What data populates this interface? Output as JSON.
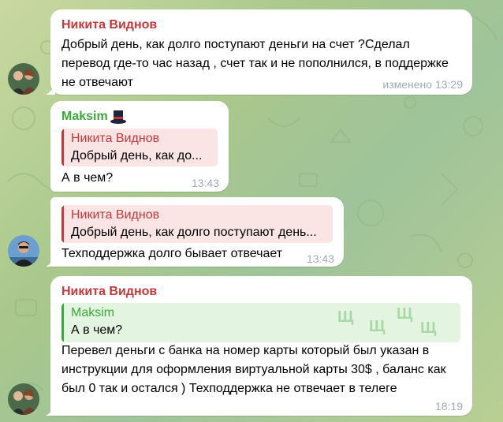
{
  "messages": [
    {
      "sender": "Никита Виднов",
      "text": "Добрый день, как долго поступают деньги на счет ?Сделал перевод где-то час назад , счет так и не пополнился, в поддержке не отвечают",
      "time": "изменено 13:29"
    },
    {
      "sender": "Maksim",
      "badge_icon": "top-hat-emoji-icon",
      "reply": {
        "name": "Никита Виднов",
        "text": "Добрый день, как до..."
      },
      "text": "А в чем?",
      "time": "13:43"
    },
    {
      "reply": {
        "name": "Никита Виднов",
        "text": "Добрый день, как долго поступают день..."
      },
      "text": "Техподдержка долго бывает отвечает",
      "time": "13:43"
    },
    {
      "sender": "Никита Виднов",
      "reply": {
        "name": "Maksim",
        "text": "А в чем?"
      },
      "text": "Перевел деньги с банка на номер карты  который был указан в инструкции  для оформления виртуальной карты 30$ , баланс как был 0 так и остался ) Техподдержка не отвечает в телеге",
      "time": "18:19"
    }
  ],
  "watermark_glyph": "Щ",
  "colors": {
    "sender_red": "#c0393b",
    "sender_green": "#3aa83a",
    "time_gray": "#a0acb6",
    "bubble_bg": "#ffffff"
  }
}
